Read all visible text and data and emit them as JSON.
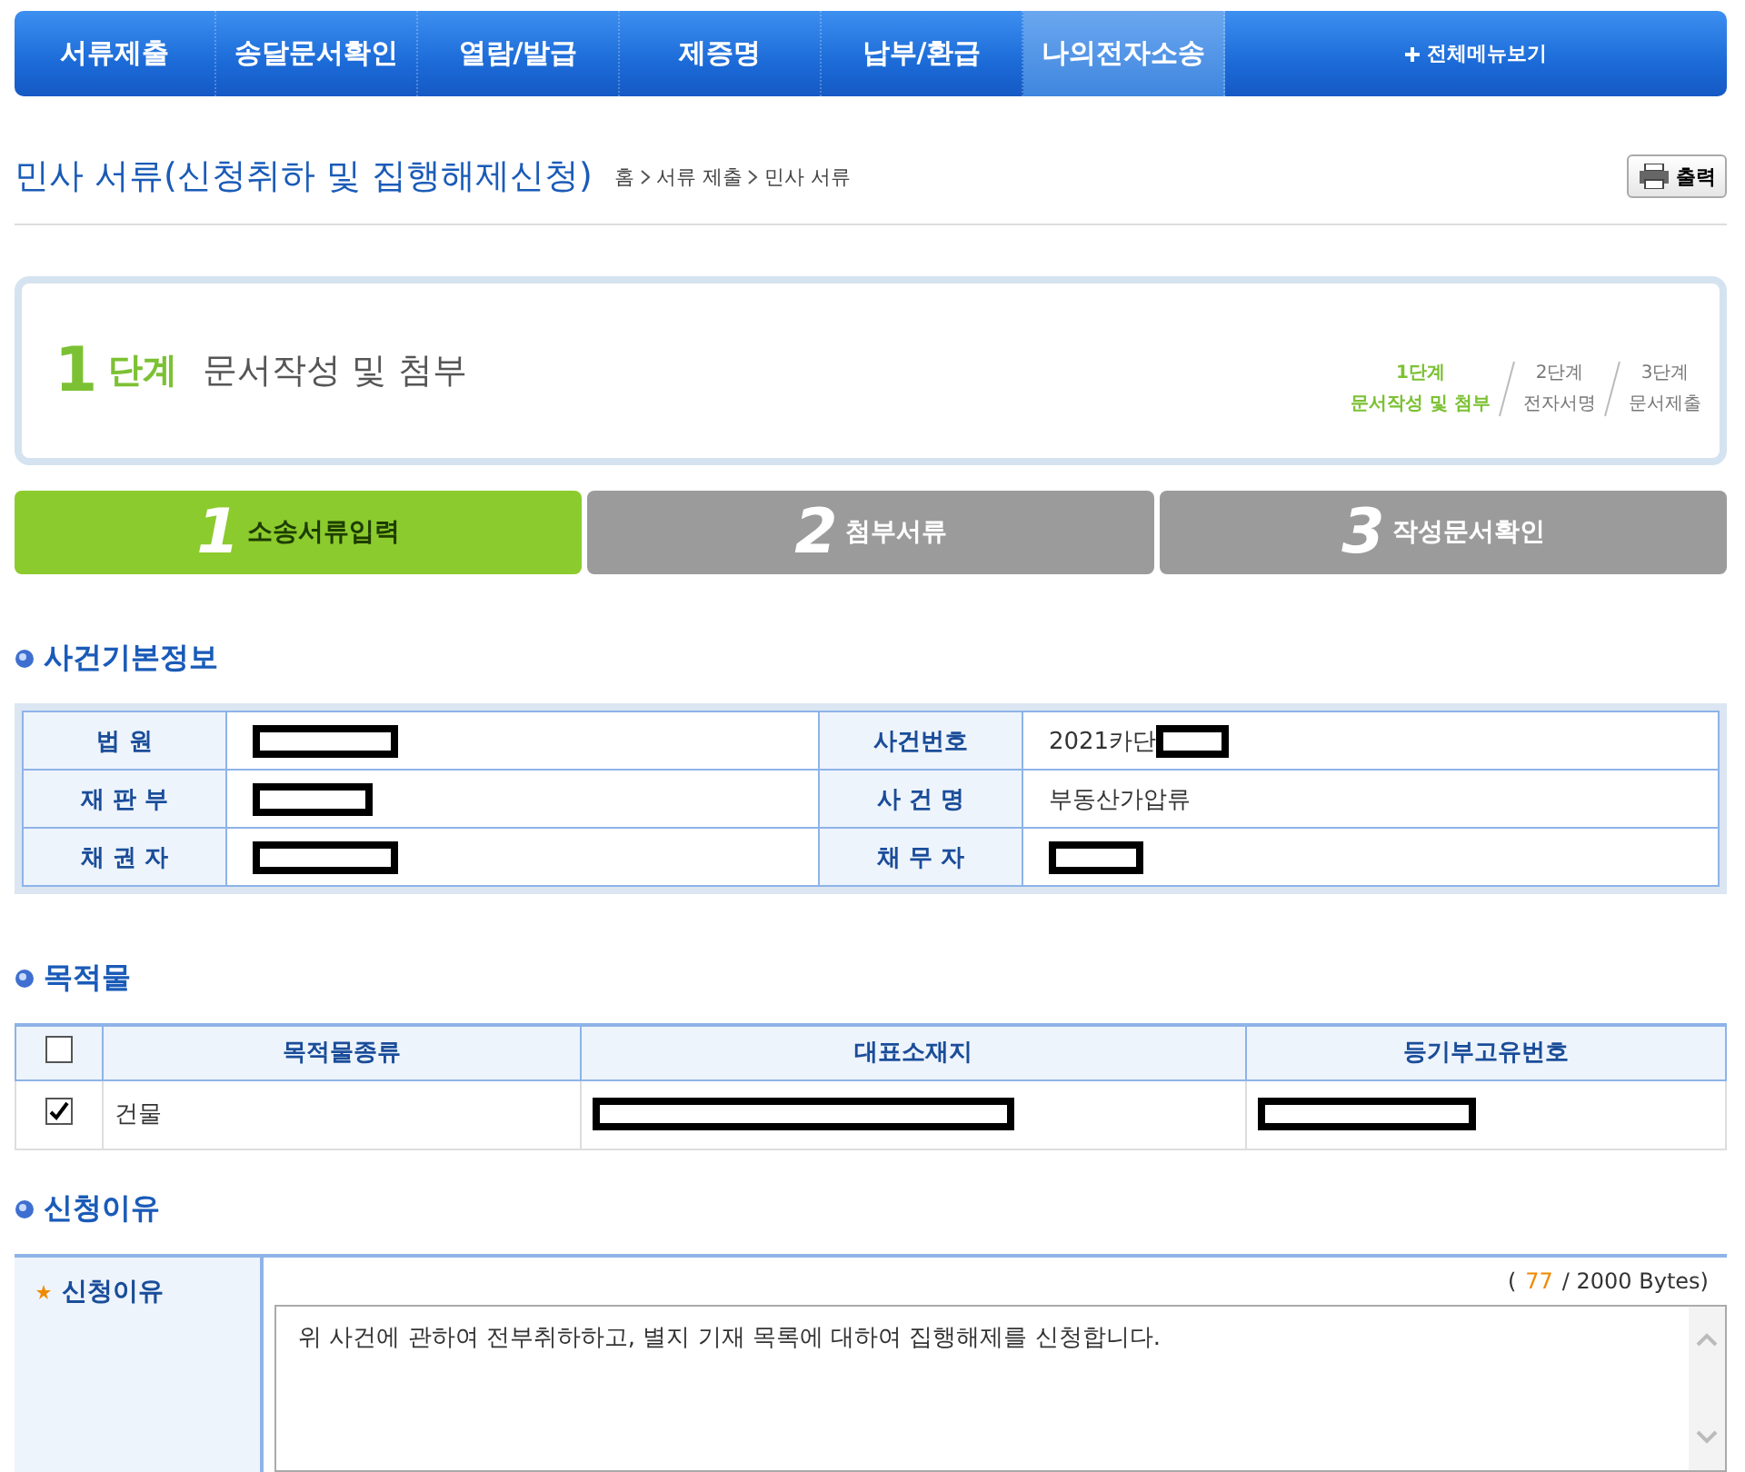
{
  "nav": {
    "items": [
      {
        "label": "서류제출",
        "selected": false
      },
      {
        "label": "송달문서확인",
        "selected": false
      },
      {
        "label": "열람/발급",
        "selected": false
      },
      {
        "label": "제증명",
        "selected": false
      },
      {
        "label": "납부/환급",
        "selected": false
      },
      {
        "label": "나의전자소송",
        "selected": true
      }
    ],
    "all_menu": "전체메뉴보기"
  },
  "title": "민사 서류(신청취하 및 집행해제신청)",
  "breadcrumb": [
    "홈",
    "서류 제출",
    "민사 서류"
  ],
  "print_button": "출력",
  "stage": {
    "number": "1",
    "word": "단계",
    "title": "문서작성 및 첨부",
    "steps": [
      {
        "number": "1단계",
        "label": "문서작성 및 첨부",
        "selected": true
      },
      {
        "number": "2단계",
        "label": "전자서명",
        "selected": false
      },
      {
        "number": "3단계",
        "label": "문서제출",
        "selected": false
      }
    ]
  },
  "tabs": [
    {
      "number": "1",
      "label": "소송서류입력",
      "selected": true
    },
    {
      "number": "2",
      "label": "첨부서류",
      "selected": false
    },
    {
      "number": "3",
      "label": "작성문서확인",
      "selected": false
    }
  ],
  "case_info": {
    "title": "사건기본정보",
    "rows": [
      [
        {
          "label": "법 원",
          "redacted": true
        },
        {
          "label": "사건번호",
          "value": "2021카단",
          "redacted": true
        }
      ],
      [
        {
          "label": "재 판 부",
          "redacted": true
        },
        {
          "label": "사 건 명",
          "value": "부동산가압류"
        }
      ],
      [
        {
          "label": "채 권 자",
          "redacted": true
        },
        {
          "label": "채 무 자",
          "redacted": true
        }
      ]
    ]
  },
  "objects": {
    "title": "목적물",
    "select_all": false,
    "columns": [
      "목적물종류",
      "대표소재지",
      "등기부고유번호"
    ],
    "rows": [
      {
        "checked": true,
        "cells": [
          {
            "text": "건물"
          },
          {
            "redacted": true
          },
          {
            "redacted": true
          }
        ]
      }
    ]
  },
  "reason": {
    "title": "신청이유",
    "label": "신청이유",
    "required": true,
    "counter_open": "(",
    "counter_value": "77",
    "counter_rest": "/ 2000 Bytes)",
    "value": "위 사건에 관하여 전부취하하고, 별지 기재 목록에 대하여 집행해제를 신청합니다."
  }
}
